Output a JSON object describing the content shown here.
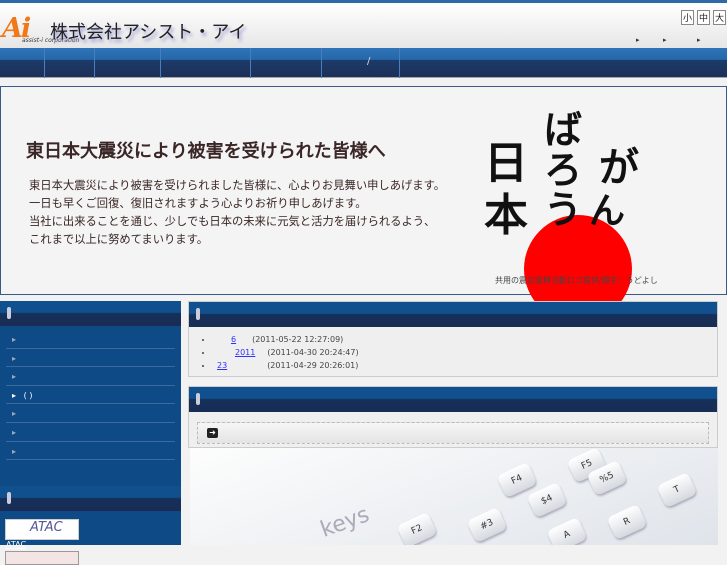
{
  "header": {
    "logo": "Ai",
    "logo_sub": "assist-i corporation",
    "company": "株式会社アシスト・アイ",
    "font_sizes": [
      "小",
      "中",
      "大"
    ],
    "links": [
      "▸",
      "▸",
      "▸"
    ]
  },
  "nav": {
    "slash": "/"
  },
  "banner": {
    "title": "東日本大震災により被害を受けられた皆様へ",
    "lines": [
      "東日本大震災により被害を受けられました皆様に、心よりお見舞い申しあげます。",
      "一日も早くご回復、復旧されますよう心よりお祈り申しあげます。",
      "当社に出来ることを通じ、少しでも日本の未来に元気と活力を届けられるよう、",
      "これまで以上に努めてまいります。"
    ],
    "logo_text": "日本がんばろう",
    "credit": "共用の震災復興活動ロゴ提供/題字：うどよし"
  },
  "sidebar": {
    "items": [
      "",
      "",
      "",
      "( )",
      "",
      "",
      ""
    ],
    "ad_label": "ATAC",
    "ad_text": "ATAC"
  },
  "news": {
    "items": [
      {
        "link": "6",
        "date": "(2011-05-22 12:27:09)"
      },
      {
        "link": "2011",
        "date": "(2011-04-30 20:24:47)"
      },
      {
        "link": "23",
        "date": "(2011-04-29 20:26:01)"
      }
    ]
  },
  "keyboard": {
    "brand": "keys",
    "keys": [
      "F2",
      "F4",
      "F5",
      "#3",
      "$4",
      "%5",
      "A",
      "R",
      "T"
    ]
  }
}
